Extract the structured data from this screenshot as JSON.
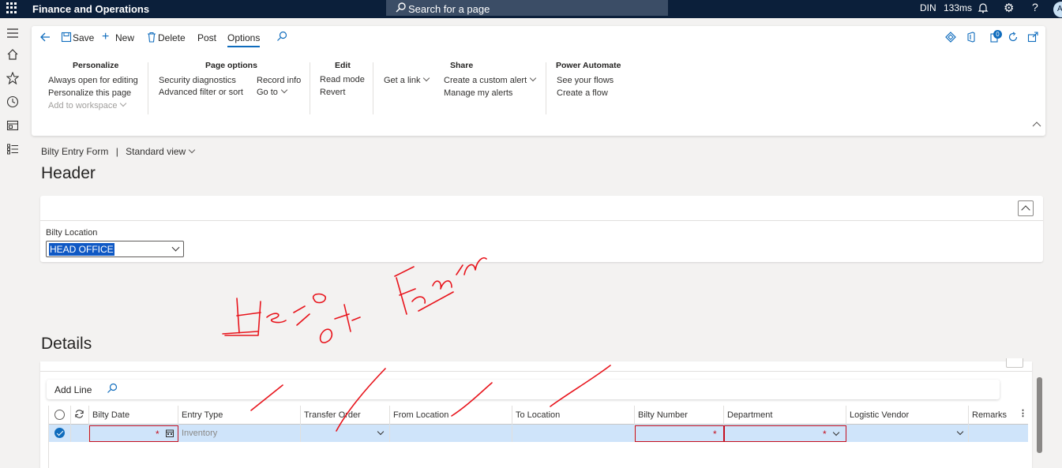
{
  "topbar": {
    "app_title": "Finance and Operations",
    "search_placeholder": "Search for a page",
    "company": "DIN",
    "timing": "133ms",
    "avatar_initial": "A"
  },
  "actions": {
    "save": "Save",
    "new": "New",
    "delete": "Delete",
    "post": "Post",
    "options": "Options"
  },
  "groups": {
    "personalize": {
      "title": "Personalize",
      "items": [
        "Always open for editing",
        "Personalize this page",
        "Add to workspace"
      ]
    },
    "page_options": {
      "title": "Page options",
      "items": [
        "Security diagnostics",
        "Advanced filter or sort",
        "Record info",
        "Go to"
      ]
    },
    "edit": {
      "title": "Edit",
      "items": [
        "Read mode",
        "Revert"
      ]
    },
    "share": {
      "title": "Share",
      "items": [
        "Get a link",
        "Create a custom alert",
        "Manage my alerts"
      ]
    },
    "power_automate": {
      "title": "Power Automate",
      "items": [
        "See your flows",
        "Create a flow"
      ]
    }
  },
  "notification_count": "0",
  "breadcrumb": {
    "form": "Bilty Entry Form",
    "separator": "|",
    "view": "Standard view"
  },
  "header": {
    "title": "Header",
    "location_label": "Bilty Location",
    "location_value": "HEAD OFFICE"
  },
  "details": {
    "title": "Details",
    "add_line": "Add Line",
    "columns": [
      "Bilty Date",
      "Entry Type",
      "Transfer Order",
      "From Location",
      "To Location",
      "Bilty Number",
      "Department",
      "Logistic Vendor",
      "Remarks"
    ],
    "row": {
      "entry_type": "Inventory",
      "required_mark": "*"
    }
  },
  "colors": {
    "topbar": "#0b1f3a",
    "accent": "#0f6cbd",
    "row_selected": "#cfe4fa",
    "required": "#c50f1f",
    "ink": "#e8141c"
  }
}
